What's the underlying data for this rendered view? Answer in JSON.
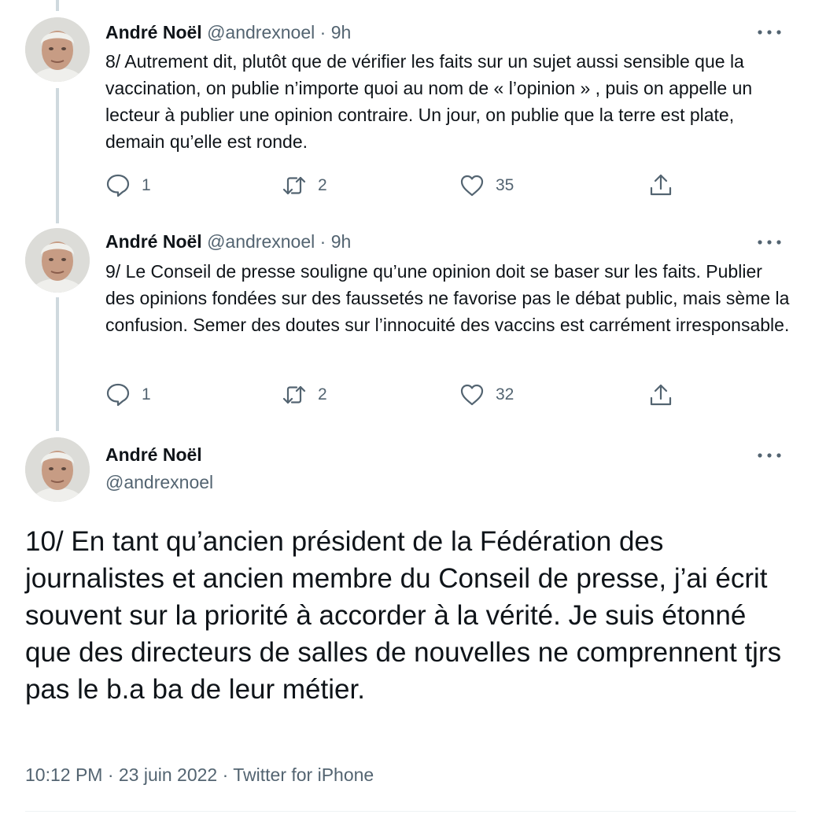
{
  "tweets": [
    {
      "author_name": "André Noël",
      "author_handle": "@andrexnoel",
      "separator": "·",
      "time_ago": "9h",
      "text": "8/ Autrement dit, plutôt que de vérifier les faits sur un sujet aussi sensible que la vaccination, on publie n’importe quoi au nom de « l’opinion » , puis on appelle un lecteur à publier une opinion contraire. Un jour, on publie que la terre est plate, demain qu’elle est ronde.",
      "replies": "1",
      "retweets": "2",
      "likes": "35"
    },
    {
      "author_name": "André Noël",
      "author_handle": "@andrexnoel",
      "separator": "·",
      "time_ago": "9h",
      "text": "9/ Le Conseil de presse souligne qu’une opinion doit se baser sur les faits. Publier des opinions fondées sur des faussetés ne favorise pas le débat public, mais sème la confusion. Semer des doutes sur l’innocuité des vaccins est carrément irresponsable.",
      "replies": "1",
      "retweets": "2",
      "likes": "32"
    }
  ],
  "main_tweet": {
    "author_name": "André Noël",
    "author_handle": "@andrexnoel",
    "text": "10/ En tant qu’ancien président de la Fédération des journalistes et ancien membre du Conseil de presse, j’ai écrit souvent sur la priorité à accorder à la vérité. Je suis étonné que des directeurs de salles de nouvelles ne comprennent tjrs pas le b.a ba de leur métier.",
    "meta": "10:12 PM · 23 juin 2022 · Twitter for iPhone"
  },
  "icons": {
    "more": "more-icon",
    "reply": "reply-icon",
    "retweet": "retweet-icon",
    "like": "like-icon",
    "share": "share-icon"
  },
  "colors": {
    "text": "#0f1419",
    "secondary": "#536471",
    "thread_line": "#cfd9de"
  }
}
